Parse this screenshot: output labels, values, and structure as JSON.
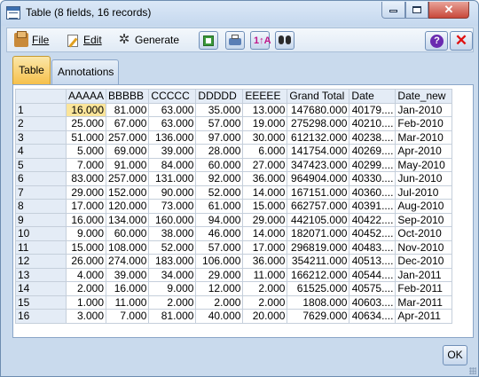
{
  "window": {
    "title": "Table (8 fields, 16 records)",
    "buttons": {
      "close": "✕"
    }
  },
  "toolbar": {
    "menus": [
      {
        "label": "File",
        "icon": "file-icon"
      },
      {
        "label": "Edit",
        "icon": "edit-icon"
      },
      {
        "label": "Generate",
        "icon": "generate-icon"
      }
    ],
    "help_label": "?",
    "close_label": "✕"
  },
  "tabs": [
    {
      "label": "Table",
      "active": true
    },
    {
      "label": "Annotations",
      "active": false
    }
  ],
  "table": {
    "columns": [
      "",
      "AAAAA",
      "BBBBB",
      "CCCCC",
      "DDDDD",
      "EEEEE",
      "Grand Total",
      "Date",
      "Date_new"
    ],
    "rows": [
      [
        "1",
        "16.000",
        "81.000",
        "63.000",
        "35.000",
        "13.000",
        "147680.000",
        "40179....",
        "Jan-2010"
      ],
      [
        "2",
        "25.000",
        "67.000",
        "63.000",
        "57.000",
        "19.000",
        "275298.000",
        "40210....",
        "Feb-2010"
      ],
      [
        "3",
        "51.000",
        "257.000",
        "136.000",
        "97.000",
        "30.000",
        "612132.000",
        "40238....",
        "Mar-2010"
      ],
      [
        "4",
        "5.000",
        "69.000",
        "39.000",
        "28.000",
        "6.000",
        "141754.000",
        "40269....",
        "Apr-2010"
      ],
      [
        "5",
        "7.000",
        "91.000",
        "84.000",
        "60.000",
        "27.000",
        "347423.000",
        "40299....",
        "May-2010"
      ],
      [
        "6",
        "83.000",
        "257.000",
        "131.000",
        "92.000",
        "36.000",
        "964904.000",
        "40330....",
        "Jun-2010"
      ],
      [
        "7",
        "29.000",
        "152.000",
        "90.000",
        "52.000",
        "14.000",
        "167151.000",
        "40360....",
        "Jul-2010"
      ],
      [
        "8",
        "17.000",
        "120.000",
        "73.000",
        "61.000",
        "15.000",
        "662757.000",
        "40391....",
        "Aug-2010"
      ],
      [
        "9",
        "16.000",
        "134.000",
        "160.000",
        "94.000",
        "29.000",
        "442105.000",
        "40422....",
        "Sep-2010"
      ],
      [
        "10",
        "9.000",
        "60.000",
        "38.000",
        "46.000",
        "14.000",
        "182071.000",
        "40452....",
        "Oct-2010"
      ],
      [
        "11",
        "15.000",
        "108.000",
        "52.000",
        "57.000",
        "17.000",
        "296819.000",
        "40483....",
        "Nov-2010"
      ],
      [
        "12",
        "26.000",
        "274.000",
        "183.000",
        "106.000",
        "36.000",
        "354211.000",
        "40513....",
        "Dec-2010"
      ],
      [
        "13",
        "4.000",
        "39.000",
        "34.000",
        "29.000",
        "11.000",
        "166212.000",
        "40544....",
        "Jan-2011"
      ],
      [
        "14",
        "2.000",
        "16.000",
        "9.000",
        "12.000",
        "2.000",
        "61525.000",
        "40575....",
        "Feb-2011"
      ],
      [
        "15",
        "1.000",
        "11.000",
        "2.000",
        "2.000",
        "2.000",
        "1808.000",
        "40603....",
        "Mar-2011"
      ],
      [
        "16",
        "3.000",
        "7.000",
        "81.000",
        "40.000",
        "20.000",
        "7629.000",
        "40634....",
        "Apr-2011"
      ]
    ]
  },
  "ok_label": "OK"
}
